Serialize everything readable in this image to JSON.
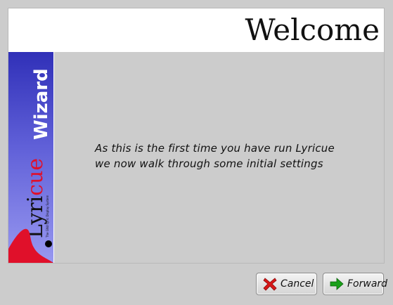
{
  "header": {
    "title": "Welcome"
  },
  "sidebar": {
    "brand_prefix": "Lyri",
    "brand_accent": "cue",
    "tagline": "The GNU Lyric Display System",
    "wizard_label": "Wizard"
  },
  "content": {
    "line1": "As this is the first time you have run Lyricue",
    "line2": "we now walk through some initial settings"
  },
  "buttons": {
    "cancel_label": "Cancel",
    "forward_label": "Forward"
  },
  "colors": {
    "accent": "#e0102a",
    "forward_arrow": "#1aa01a",
    "cancel_x": "#d81818"
  },
  "icons": {
    "cancel": "cancel-x-icon",
    "forward": "forward-arrow-icon",
    "logo": "lyricue-logo-icon"
  }
}
